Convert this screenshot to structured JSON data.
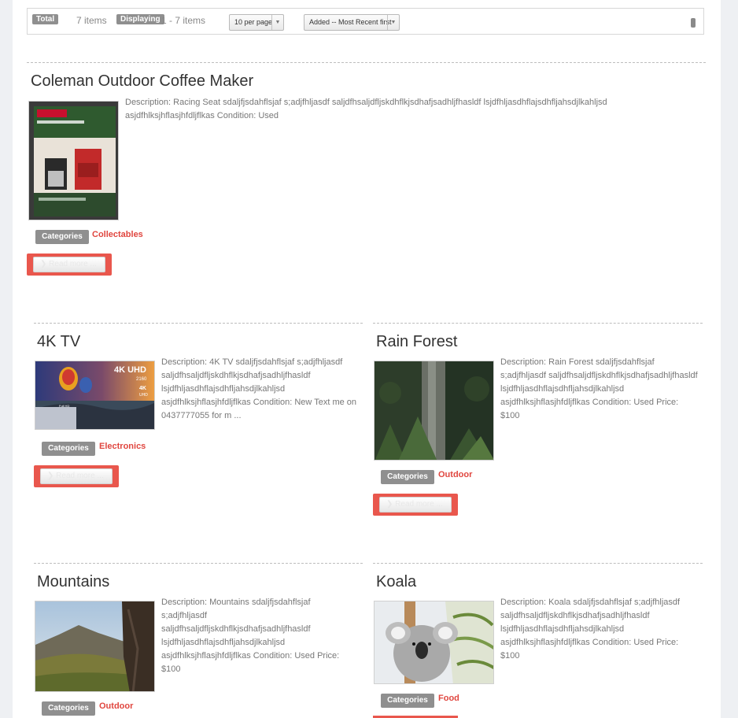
{
  "toolbar": {
    "total_label": "Total",
    "total_value": "7 items",
    "displaying_label": "Displaying",
    "displaying_value": "1 - 7 items",
    "per_page": "10 per page",
    "sort": "Added -- Most Recent first"
  },
  "items": [
    {
      "title": "Coleman Outdoor Coffee Maker",
      "description": "Description: Racing Seat sdaljfjsdahflsjaf s;adjfhljasdf saljdfhsaljdfljskdhflkjsdhafjsadhljfhasldf lsjdfhljasdhflajsdhfljahsdjlkahljsd asjdfhlksjhflasjhfdljflkas Condition: Used",
      "categories_label": "Categories",
      "category": "Collectables",
      "read_more": "Read more ..."
    },
    {
      "title": "4K TV",
      "description": "Description: 4K TV sdaljfjsdahflsjaf s;adjfhljasdf saljdfhsaljdfljskdhflkjsdhafjsadhljfhasldf lsjdfhljasdhflajsdhfljahsdjlkahljsd asjdfhlksjhflasjhfdljflkas Condition: New Text me on 0437777055 for m ...",
      "categories_label": "Categories",
      "category": "Electronics",
      "read_more": "Read more ...",
      "image_text": {
        "brand": "4K UHD",
        "sub": "2160",
        "badge": "4K",
        "badge_sub": "UHD",
        "fhd": "Full HD"
      }
    },
    {
      "title": "Rain Forest",
      "description": "Description: Rain Forest sdaljfjsdahflsjaf s;adjfhljasdf saljdfhsaljdfljskdhflkjsdhafjsadhljfhasldf lsjdfhljasdhflajsdhfljahsdjlkahljsd asjdfhlksjhflasjhfdljflkas Condition: Used Price: $100",
      "categories_label": "Categories",
      "category": "Outdoor",
      "read_more": "Read more ..."
    },
    {
      "title": "Mountains",
      "description": "Description: Mountains sdaljfjsdahflsjaf s;adjfhljasdf saljdfhsaljdfljskdhflkjsdhafjsadhljfhasldf lsjdfhljasdhflajsdhfljahsdjlkahljsd asjdfhlksjhflasjhfdljflkas Condition: Used Price: $100",
      "categories_label": "Categories",
      "category": "Outdoor"
    },
    {
      "title": "Koala",
      "description": "Description: Koala sdaljfjsdahflsjaf s;adjfhljasdf saljdfhsaljdfljskdhflkjsdhafjsadhljfhasldf lsjdfhljasdhflajsdhfljahsdjlkahljsd asjdfhlksjhflasjhfdljflkas Condition: Used Price: $100",
      "categories_label": "Categories",
      "category": "Food"
    }
  ],
  "colors": {
    "accent": "#e0463f",
    "button_highlight": "#e9574d",
    "badge": "#8f8f8f"
  }
}
